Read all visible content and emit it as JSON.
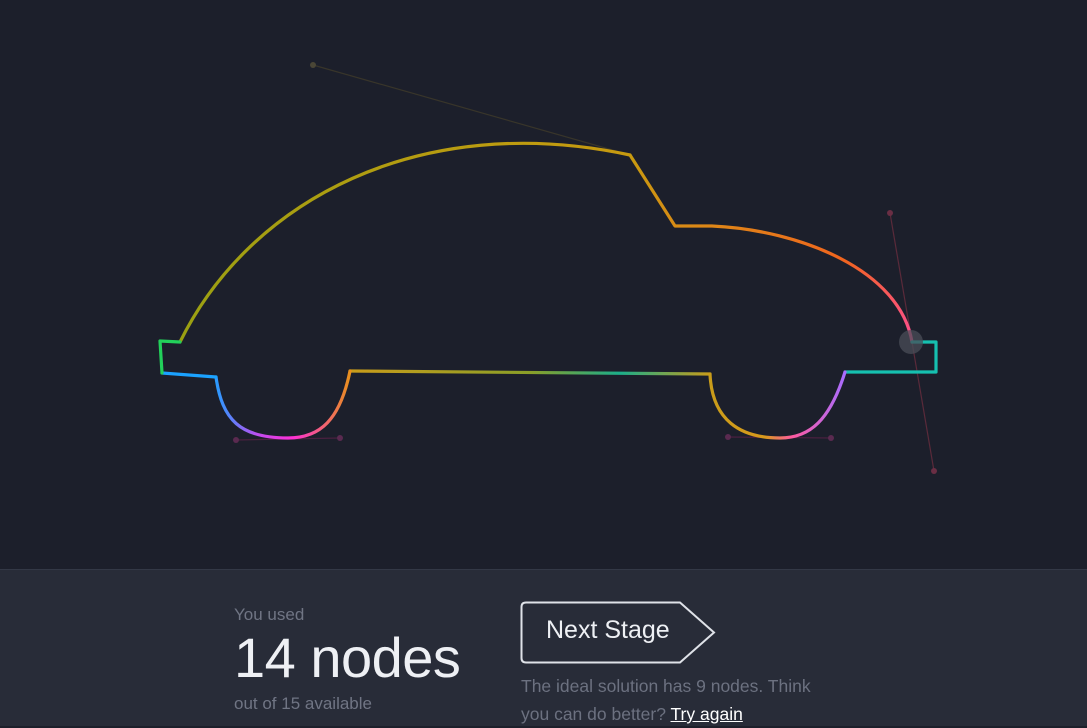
{
  "result": {
    "used_label": "You used",
    "nodes_used": "14 nodes",
    "available": "out of 15 available",
    "next_label": "Next Stage",
    "hint_text": "The ideal solution has 9 nodes. Think you can do better?",
    "try_again": "Try again"
  },
  "shape": {
    "name": "car",
    "stroke_gradient": [
      "#9aa012",
      "#c79a10",
      "#f0641e",
      "#ff4f8e",
      "#16c0b0",
      "#a86cff",
      "#ff2fd6",
      "#1ba2ff",
      "#22d05a"
    ]
  }
}
